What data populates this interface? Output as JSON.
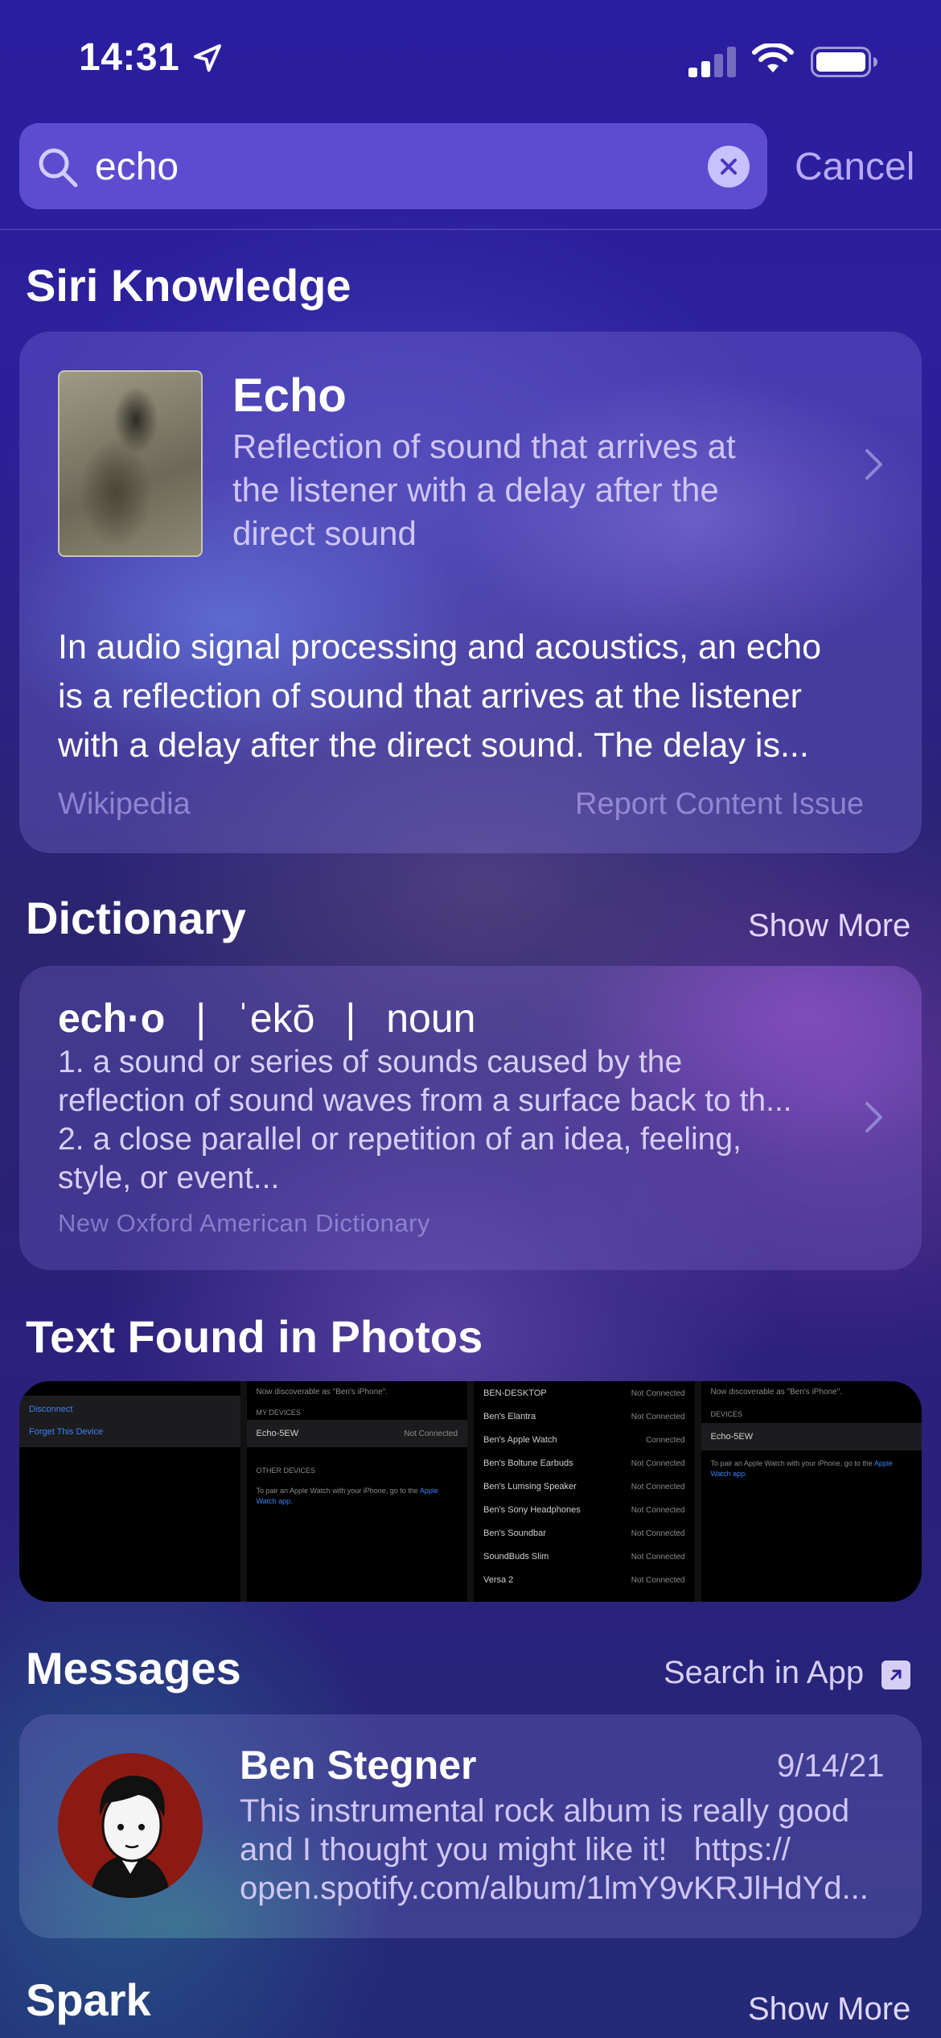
{
  "status_bar": {
    "time": "14:31"
  },
  "search": {
    "query": "echo",
    "cancel_label": "Cancel"
  },
  "siri_knowledge": {
    "section_title": "Siri Knowledge",
    "title": "Echo",
    "subtitle_lines": [
      "Reflection of sound that arrives at",
      "the listener with a delay after the",
      "direct sound"
    ],
    "body_lines": [
      "In audio signal processing and acoustics, an echo",
      "is a reflection of sound that arrives at the listener",
      "with a delay after the direct sound. The delay is..."
    ],
    "source": "Wikipedia",
    "report_label": "Report Content Issue"
  },
  "dictionary": {
    "section_title": "Dictionary",
    "show_more_label": "Show More",
    "headword": "ech·o",
    "pronunciation": "ˈekō",
    "part_of_speech": "noun",
    "separator": "|",
    "definition_lines": [
      "1. a sound or series of sounds caused by the",
      "reflection of sound waves from a surface back to th...",
      "2. a close parallel or repetition of an idea, feeling,",
      "style, or event..."
    ],
    "source": "New Oxford American Dictionary"
  },
  "photos": {
    "section_title": "Text Found in Photos",
    "photo1": {
      "disconnect": "Disconnect",
      "forget": "Forget This Device"
    },
    "photo2": {
      "discoverable": "Now discoverable as \"Ben's iPhone\".",
      "my_devices": "MY DEVICES",
      "device": "Echo-5EW",
      "status": "Not Connected",
      "other_devices": "OTHER DEVICES",
      "pair_note": "To pair an Apple Watch with your iPhone, go to the",
      "pair_link": "Apple Watch app."
    },
    "photo3": {
      "rows": [
        {
          "name": "BEN-DESKTOP",
          "status": "Not Connected"
        },
        {
          "name": "Ben's Elantra",
          "status": "Not Connected"
        },
        {
          "name": "Ben's Apple Watch",
          "status": "Connected"
        },
        {
          "name": "Ben's Boltune Earbuds",
          "status": "Not Connected"
        },
        {
          "name": "Ben's Lumsing Speaker",
          "status": "Not Connected"
        },
        {
          "name": "Ben's Sony Headphones",
          "status": "Not Connected"
        },
        {
          "name": "Ben's Soundbar",
          "status": "Not Connected"
        },
        {
          "name": "SoundBuds Slim",
          "status": "Not Connected"
        },
        {
          "name": "Versa 2",
          "status": "Not Connected"
        }
      ]
    },
    "photo4": {
      "discoverable": "Now discoverable as \"Ben's iPhone\".",
      "devices": "DEVICES",
      "device": "Echo-5EW",
      "pair_note": "To pair an Apple Watch with your iPhone, go to the",
      "pair_link": "Apple Watch app."
    }
  },
  "messages": {
    "section_title": "Messages",
    "search_in_app_label": "Search in App",
    "sender": "Ben Stegner",
    "date": "9/14/21",
    "body_lines": [
      "This instrumental rock album is really good",
      "and I thought you might like it!   https://",
      "open.spotify.com/album/1lmY9vKRJlHdYd..."
    ]
  },
  "spark": {
    "section_title": "Spark",
    "show_more_label": "Show More"
  },
  "colors": {
    "accent": "#b7a9ff",
    "ios_link_blue": "#3b82f6"
  },
  "icons": [
    "location-arrow-icon",
    "cellular-signal-icon",
    "wifi-icon",
    "battery-icon",
    "search-icon",
    "clear-icon",
    "chevron-right-icon",
    "open-in-app-icon"
  ]
}
